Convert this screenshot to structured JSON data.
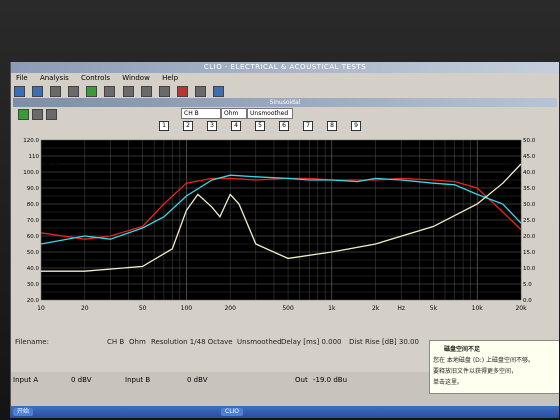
{
  "window": {
    "title": "CLIO - ELECTRICAL & ACOUSTICAL TESTS"
  },
  "menu": [
    "File",
    "Analysis",
    "Controls",
    "Window",
    "Help"
  ],
  "subwindow": {
    "title": "Sinusoidal"
  },
  "controls": {
    "channel": "CH B",
    "units": "Ohm",
    "smoothing": "Unsmoothed"
  },
  "checkboxes": [
    "1",
    "2",
    "3",
    "4",
    "5",
    "6",
    "7",
    "8",
    "9"
  ],
  "chart_data": {
    "type": "line",
    "xscale": "log",
    "xlim": [
      10,
      20000
    ],
    "ylim_left": [
      20,
      120
    ],
    "y_left_label": "dBSPL",
    "y_right_label": "Ohm",
    "x_ticks": [
      "10",
      "20",
      "50",
      "100",
      "200",
      "500",
      "1k",
      "2k",
      "Hz",
      "5k",
      "10k",
      "20k"
    ],
    "y_ticks": [
      "120.0",
      "110",
      "100.0",
      "90.0",
      "80.0",
      "70.0",
      "60.0",
      "50.0",
      "40.0",
      "30.0",
      "20.0"
    ],
    "right_ticks": [
      "50.0",
      "45.0",
      "40.0",
      "35.0",
      "30.0",
      "25.0",
      "20.0",
      "15.0",
      "10.0",
      "5.0",
      "0.0"
    ],
    "series": [
      {
        "color": "#e8231e",
        "points": [
          [
            10,
            62
          ],
          [
            20,
            58
          ],
          [
            30,
            60
          ],
          [
            50,
            66
          ],
          [
            70,
            80
          ],
          [
            100,
            93
          ],
          [
            150,
            96
          ],
          [
            200,
            96
          ],
          [
            300,
            95
          ],
          [
            500,
            96
          ],
          [
            700,
            96
          ],
          [
            1000,
            95
          ],
          [
            1500,
            95
          ],
          [
            2000,
            95
          ],
          [
            3000,
            96
          ],
          [
            5000,
            95
          ],
          [
            7000,
            94
          ],
          [
            10000,
            90
          ],
          [
            15000,
            75
          ],
          [
            20000,
            64
          ]
        ]
      },
      {
        "color": "#3ad7e6",
        "points": [
          [
            10,
            55
          ],
          [
            20,
            60
          ],
          [
            30,
            58
          ],
          [
            50,
            65
          ],
          [
            70,
            72
          ],
          [
            100,
            85
          ],
          [
            150,
            95
          ],
          [
            200,
            98
          ],
          [
            300,
            97
          ],
          [
            500,
            96
          ],
          [
            700,
            95
          ],
          [
            1000,
            95
          ],
          [
            1500,
            94
          ],
          [
            2000,
            96
          ],
          [
            3000,
            95
          ],
          [
            5000,
            93
          ],
          [
            7000,
            92
          ],
          [
            10000,
            86
          ],
          [
            15000,
            80
          ],
          [
            20000,
            68
          ]
        ]
      },
      {
        "color": "#f2edc8",
        "points": [
          [
            10,
            38
          ],
          [
            20,
            38
          ],
          [
            50,
            41
          ],
          [
            80,
            52
          ],
          [
            100,
            76
          ],
          [
            120,
            86
          ],
          [
            150,
            78
          ],
          [
            170,
            72
          ],
          [
            200,
            86
          ],
          [
            230,
            80
          ],
          [
            300,
            55
          ],
          [
            500,
            46
          ],
          [
            1000,
            50
          ],
          [
            2000,
            55
          ],
          [
            5000,
            66
          ],
          [
            10000,
            80
          ],
          [
            15000,
            93
          ],
          [
            20000,
            105
          ]
        ]
      }
    ]
  },
  "status": {
    "filename": "Filename:",
    "channel": "CH B",
    "units": "Ohm",
    "resolution": "Resolution 1/48 Octave",
    "smoothing": "Unsmoothed",
    "delay": "Delay [ms] 0.000",
    "dist_rise": "Dist Rise [dB] 30.00"
  },
  "bottom": {
    "input_a": "Input A",
    "input_a_val": "0 dBV",
    "input_b": "Input B",
    "input_b_val": "0 dBV",
    "output": "Out",
    "output_val": "-19.0 dBu"
  },
  "balloon": {
    "title": "磁盘空间不足",
    "line1": "您在 本地磁盘 (D:) 上磁盘空间不够。",
    "line2": "要释放旧文件以获得更多空间，",
    "line3": "单击这里。"
  },
  "taskbar": [
    "开始",
    "CLIO"
  ]
}
